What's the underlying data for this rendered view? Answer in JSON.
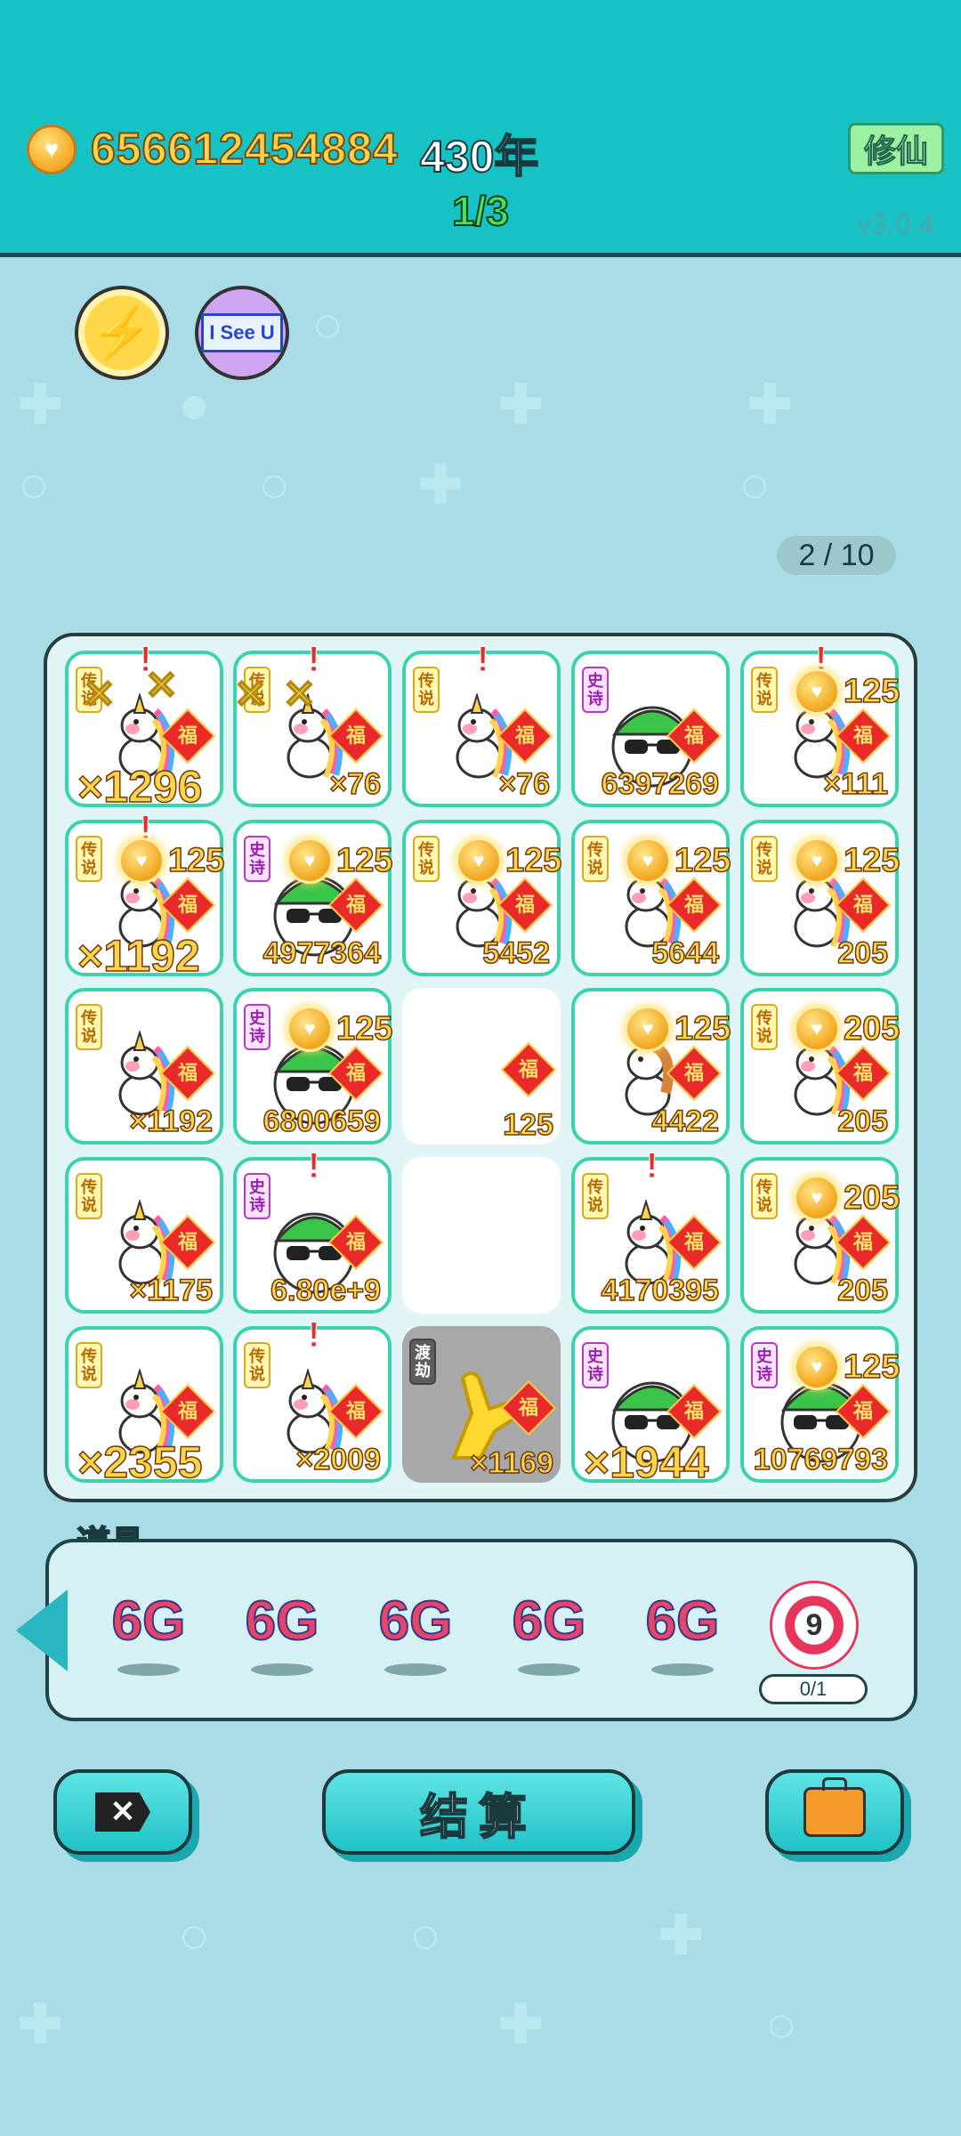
{
  "header": {
    "coin_amount": "656612454884",
    "years": "430年",
    "page": "1/3",
    "mode_button": "修仙",
    "version": "v3.0.4"
  },
  "buttons": {
    "iseeu_label": "I See U",
    "settle_label": "结算"
  },
  "pager": "2 / 10",
  "tags": {
    "legend": "传说",
    "epic": "史诗",
    "dao": "渡劫",
    "fu": "福"
  },
  "grid": [
    [
      {
        "tag": "传说",
        "char": "unicorn",
        "count": "×1296",
        "big": true,
        "alert": true
      },
      {
        "tag": "传说",
        "char": "unicorn",
        "count": "×76",
        "alert": true
      },
      {
        "tag": "传说",
        "char": "unicorn",
        "count": "×76",
        "alert": true
      },
      {
        "tag": "史诗",
        "char": "man",
        "count": "6397269"
      },
      {
        "tag": "传说",
        "char": "unicorn",
        "count": "×111",
        "alert": true
      }
    ],
    [
      {
        "tag": "传说",
        "char": "unicorn",
        "count": "×1192",
        "big": true,
        "alert": true
      },
      {
        "tag": "史诗",
        "char": "man",
        "count": "4977364"
      },
      {
        "tag": "传说",
        "char": "unicorn",
        "count": "5452"
      },
      {
        "tag": "传说",
        "char": "unicorn",
        "count": "5644"
      },
      {
        "tag": "传说",
        "char": "unicorn",
        "count": "205"
      }
    ],
    [
      {
        "tag": "传说",
        "char": "unicorn",
        "count": "×1192"
      },
      {
        "tag": "史诗",
        "char": "man",
        "count": "6800659"
      },
      {
        "tag": "",
        "char": "empty",
        "count": "125"
      },
      {
        "tag": "",
        "char": "horse",
        "count": "4422"
      },
      {
        "tag": "传说",
        "char": "unicorn",
        "count": "205"
      }
    ],
    [
      {
        "tag": "传说",
        "char": "unicorn",
        "count": "×1175"
      },
      {
        "tag": "史诗",
        "char": "man",
        "count": "6.80e+9",
        "alert": true
      },
      {
        "tag": "",
        "char": "empty",
        "count": ""
      },
      {
        "tag": "传说",
        "char": "unicorn",
        "count": "4170395",
        "alert": true
      },
      {
        "tag": "传说",
        "char": "unicorn",
        "count": "205"
      }
    ],
    [
      {
        "tag": "传说",
        "char": "unicorn",
        "count": "×2355",
        "big": true
      },
      {
        "tag": "传说",
        "char": "unicorn",
        "count": "×2009",
        "alert": true
      },
      {
        "tag": "渡劫",
        "char": "hand",
        "count": "×1169"
      },
      {
        "tag": "史诗",
        "char": "man",
        "count": "×1944",
        "big": true
      },
      {
        "tag": "史诗",
        "char": "man",
        "count": "10769793"
      }
    ]
  ],
  "coin_pop_value": "125",
  "coin_pop_value_alt": "205",
  "tools": {
    "label": "道具",
    "items": [
      "6G",
      "6G",
      "6G",
      "6G",
      "6G"
    ],
    "target_number": "9",
    "target_count": "0/1"
  }
}
